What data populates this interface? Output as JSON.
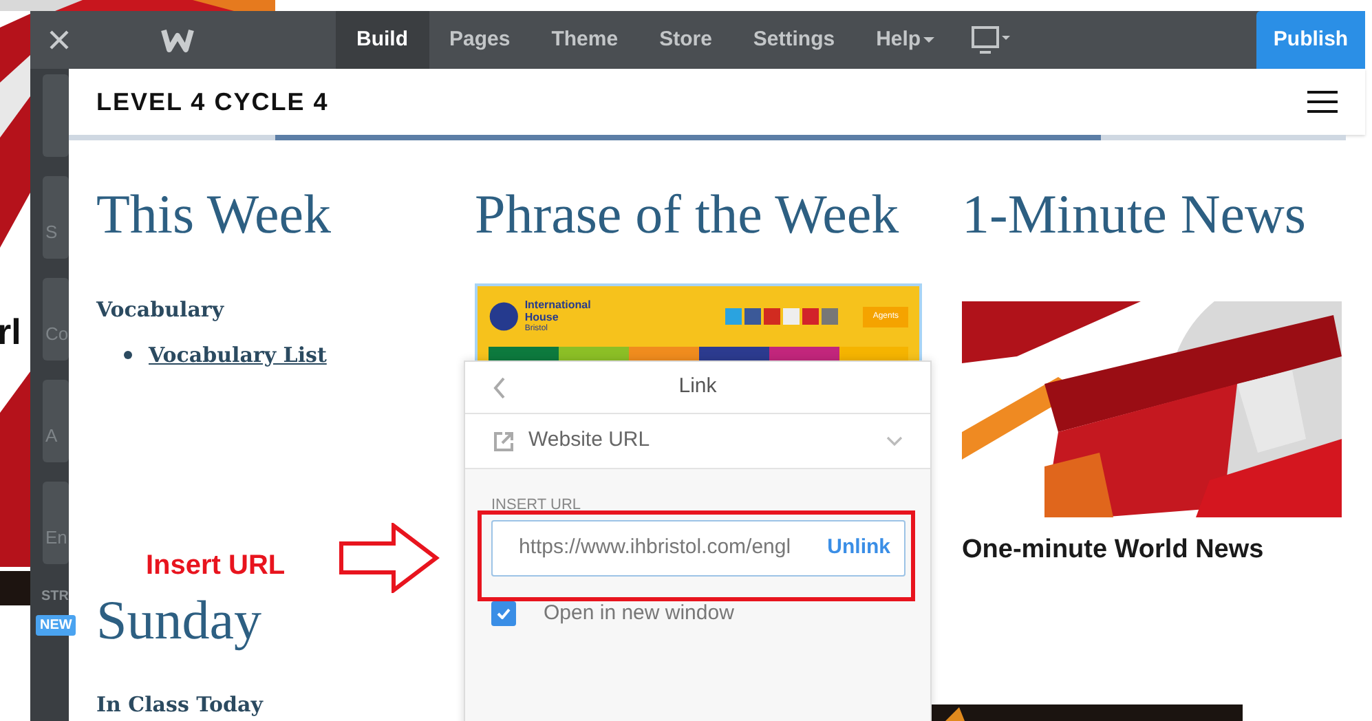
{
  "background": {
    "text": "rl"
  },
  "toolbar": {
    "tabs": [
      {
        "label": "Build",
        "selected": true,
        "caret": false
      },
      {
        "label": "Pages",
        "selected": false,
        "caret": false
      },
      {
        "label": "Theme",
        "selected": false,
        "caret": false
      },
      {
        "label": "Store",
        "selected": false,
        "caret": false
      },
      {
        "label": "Settings",
        "selected": false,
        "caret": false
      },
      {
        "label": "Help",
        "selected": false,
        "caret": true
      }
    ],
    "publish": "Publish"
  },
  "sidebar": {
    "items": [
      {
        "kind": "blank"
      },
      {
        "kind": "labeled",
        "label": "S"
      },
      {
        "kind": "labeled",
        "label": "Co"
      },
      {
        "kind": "labeled",
        "label": "A"
      },
      {
        "kind": "labeled",
        "label": "En"
      }
    ],
    "section": "STR",
    "badge": "NEW"
  },
  "site": {
    "title": "LEVEL 4 CYCLE 4",
    "columns": [
      {
        "heading": "This Week",
        "kind": "text",
        "subheading": "Vocabulary",
        "links": [
          "Vocabulary List"
        ],
        "heading_2": "Sunday",
        "subheading_2": "In Class Today"
      },
      {
        "heading": "Phrase of the Week",
        "kind": "screenshot",
        "brand": "International House",
        "brand_sub": "Bristol",
        "button": "Agents"
      },
      {
        "heading": "1-Minute News",
        "kind": "video",
        "caption": "One-minute World News"
      }
    ]
  },
  "link_panel": {
    "title": "Link",
    "type": "Website URL",
    "field_label": "INSERT URL",
    "url": "https://www.ihbristol.com/engl",
    "unlink": "Unlink",
    "new_window": {
      "label": "Open in new window",
      "checked": true
    }
  },
  "annotation": {
    "text": "Insert URL"
  }
}
